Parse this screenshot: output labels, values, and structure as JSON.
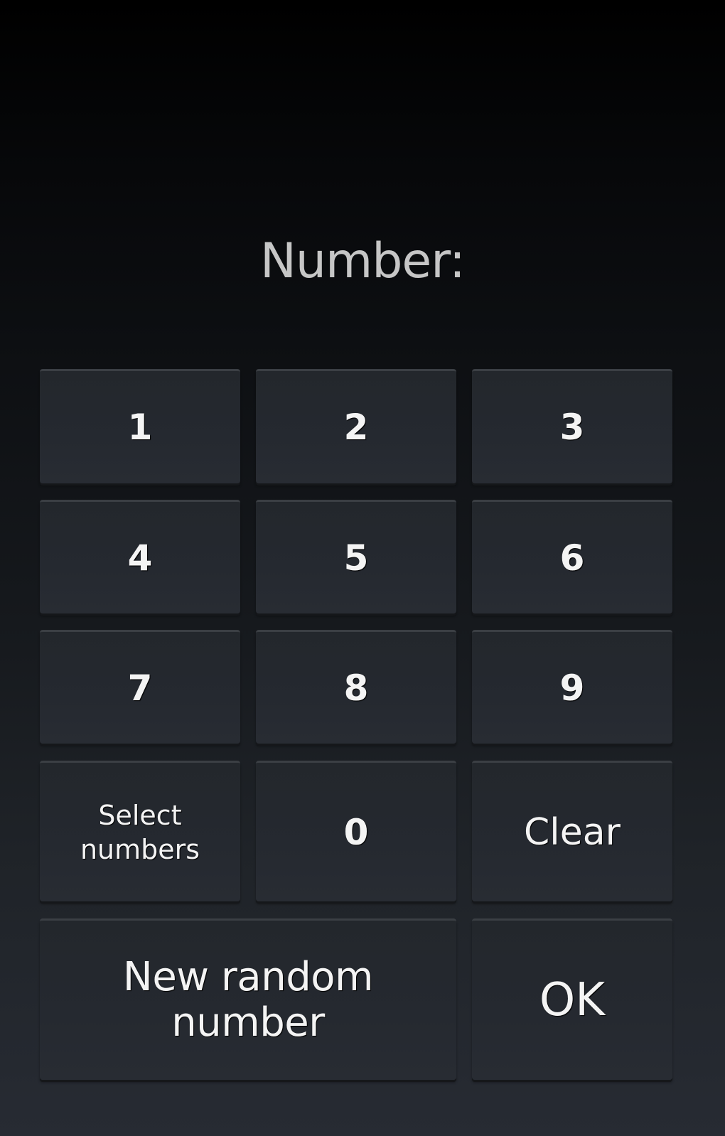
{
  "display": {
    "label": "Number:"
  },
  "keypad": {
    "digits": {
      "one": "1",
      "two": "2",
      "three": "3",
      "four": "4",
      "five": "5",
      "six": "6",
      "seven": "7",
      "eight": "8",
      "nine": "9",
      "zero": "0"
    },
    "select_numbers_line1": "Select",
    "select_numbers_line2": "numbers",
    "clear_label": "Clear",
    "new_random_line1": "New random",
    "new_random_line2": "number",
    "ok_label": "OK"
  },
  "colors": {
    "background_top": "#000000",
    "background_bottom": "#282c34",
    "button_fill": "#25292f",
    "button_text": "#f4f4f4",
    "label_text": "#c6c6c6"
  }
}
